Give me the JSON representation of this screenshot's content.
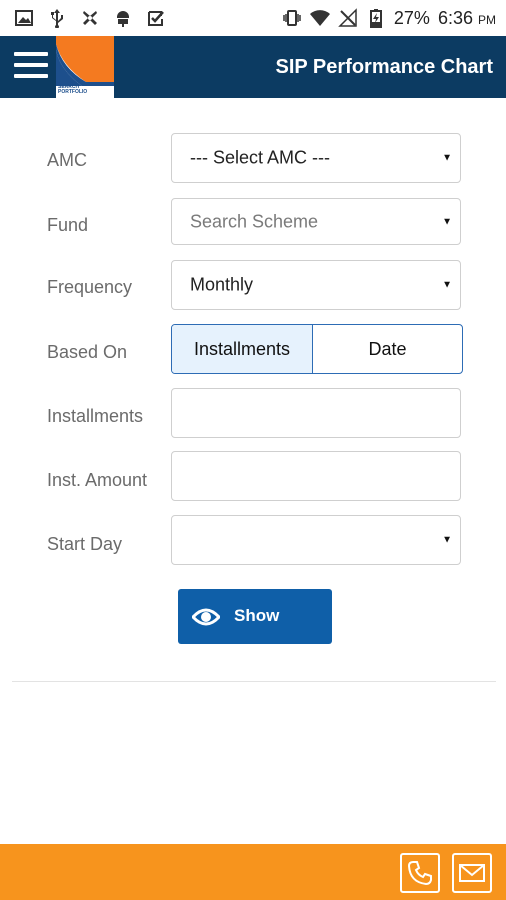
{
  "status_bar": {
    "battery": "27%",
    "time": "6:36",
    "ampm": "PM"
  },
  "app_bar": {
    "title": "SIP Performance Chart",
    "logo_text_line1": "SEARCH",
    "logo_text_line2": "PORTFOLIO"
  },
  "form": {
    "amc": {
      "label": "AMC",
      "value": "--- Select AMC ---"
    },
    "fund": {
      "label": "Fund",
      "placeholder": "Search Scheme"
    },
    "frequency": {
      "label": "Frequency",
      "value": "Monthly"
    },
    "based_on": {
      "label": "Based On",
      "options": [
        "Installments",
        "Date"
      ],
      "selected": "Installments"
    },
    "installments": {
      "label": "Installments",
      "value": ""
    },
    "inst_amount": {
      "label": "Inst. Amount",
      "value": ""
    },
    "start_day": {
      "label": "Start Day",
      "value": ""
    },
    "show_button": "Show"
  },
  "colors": {
    "app_bar": "#0c3b62",
    "primary_button": "#0f5fa8",
    "footer": "#f7941d",
    "segment_active": "#e6f2fd"
  },
  "icons": {
    "status_left": [
      "image-icon",
      "usb-icon",
      "app-icon",
      "android-icon",
      "checkbox-icon"
    ],
    "status_right": [
      "vibrate-icon",
      "wifi-icon",
      "no-signal-icon",
      "battery-charging-icon"
    ],
    "footer": [
      "phone-icon",
      "mail-icon"
    ]
  }
}
